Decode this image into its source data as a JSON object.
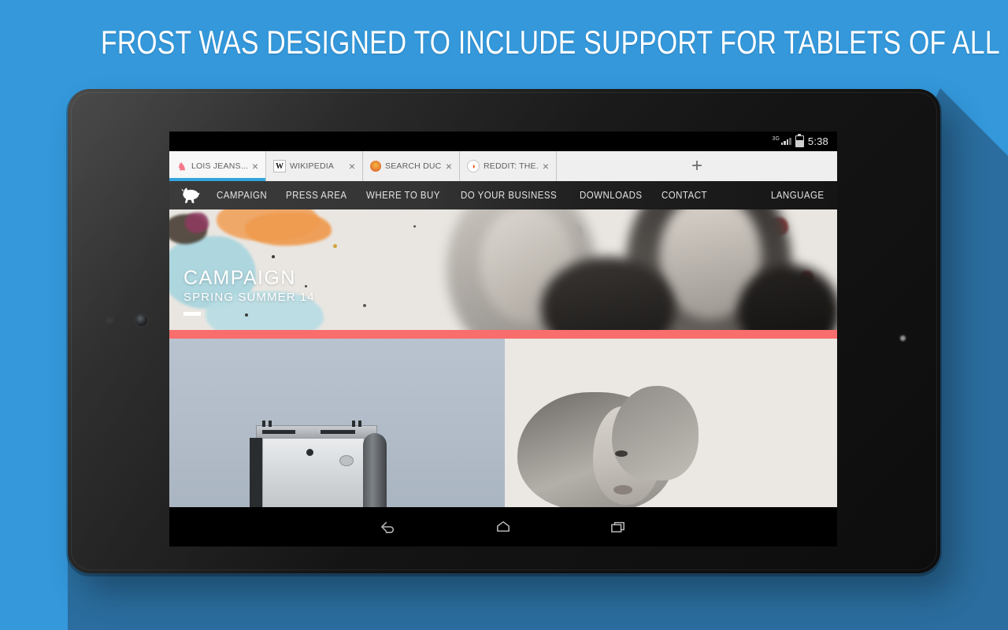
{
  "promo": {
    "headline": "FROST WAS DESIGNED TO INCLUDE SUPPORT FOR TABLETS OF ALL SIZES",
    "background_color": "#3498DB",
    "shadow_color": "#2A6D9E",
    "headline_color": "#FFFFFF"
  },
  "device": {
    "name": "android-tablet",
    "bezel_color": "#161616",
    "camera": "front-camera",
    "led": "notification-led"
  },
  "statusbar": {
    "network_label": "3G",
    "signal_icon": "signal-bars-icon",
    "battery_icon": "battery-icon",
    "time": "5:38"
  },
  "browser": {
    "name": "Frost",
    "active_tab_index": 0,
    "active_tab_underline_color": "#33A4DC",
    "new_tab_label": "+",
    "close_label": "×",
    "tabs": [
      {
        "label": "LOIS JEANS....",
        "favicon": "horse-favicon",
        "favicon_glyph": "♞",
        "active": true
      },
      {
        "label": "WIKIPEDIA",
        "favicon": "wikipedia-favicon",
        "favicon_glyph": "W",
        "active": false
      },
      {
        "label": "SEARCH DUC...",
        "favicon": "duckduckgo-favicon",
        "favicon_glyph": "●",
        "active": false
      },
      {
        "label": "REDDIT: THE...",
        "favicon": "reddit-favicon",
        "favicon_glyph": "◑",
        "active": false
      }
    ]
  },
  "website": {
    "logo": "bull-logo",
    "nav_items": [
      "CAMPAIGN",
      "PRESS AREA",
      "WHERE TO BUY",
      "DO YOUR BUSINESS",
      "DOWNLOADS",
      "CONTACT"
    ],
    "nav_right": "LANGUAGE",
    "hero": {
      "title": "CAMPAIGN",
      "subtitle": "SPRING SUMMER 14",
      "background": "watercolor-splatter-photo"
    },
    "divider_color": "#F96D6D",
    "panels": [
      {
        "name": "panel-camera-product",
        "background_color": "#B4BECA"
      },
      {
        "name": "panel-model-portrait",
        "background_color": "#EBE7E3"
      }
    ]
  },
  "android_navbar": {
    "buttons": [
      {
        "name": "back-button",
        "icon": "back-arrow-icon"
      },
      {
        "name": "home-button",
        "icon": "home-icon"
      },
      {
        "name": "recents-button",
        "icon": "recent-apps-icon"
      }
    ]
  }
}
